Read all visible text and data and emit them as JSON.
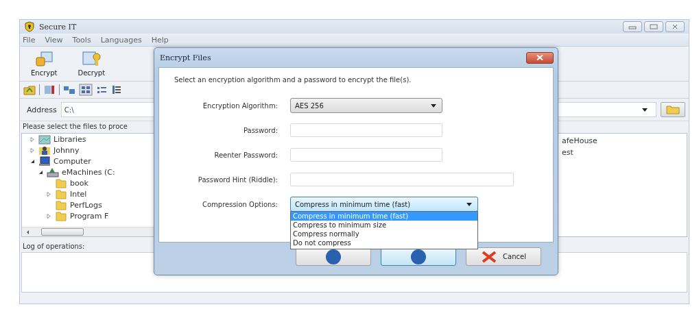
{
  "window": {
    "title": "Secure IT"
  },
  "menu": [
    "File",
    "View",
    "Tools",
    "Languages",
    "Help"
  ],
  "toolbar": [
    {
      "kind": "encrypt",
      "label": "Encrypt"
    },
    {
      "kind": "decrypt",
      "label": "Decrypt"
    }
  ],
  "address": {
    "label": "Address",
    "value": "C:\\"
  },
  "files_prompt": "Please select the files to proce",
  "tree": [
    {
      "kind": "libraries",
      "label": "Libraries",
      "expanded": false
    },
    {
      "kind": "user",
      "label": "Johnny",
      "expanded": false
    },
    {
      "kind": "computer",
      "label": "Computer",
      "expanded": true,
      "children": [
        {
          "kind": "drive",
          "label": "eMachines (C:",
          "expanded": true,
          "children": [
            {
              "kind": "folder",
              "label": "book"
            },
            {
              "kind": "folder",
              "label": "Intel",
              "expanded": false
            },
            {
              "kind": "folder",
              "label": "PerfLogs"
            },
            {
              "kind": "folder",
              "label": "Program F",
              "expanded": false
            }
          ]
        }
      ]
    }
  ],
  "file_list": [
    "afeHouse",
    "est"
  ],
  "log_label": "Log of operations:",
  "dialog": {
    "title": "Encrypt Files",
    "intro": "Select an encryption algorithm and a password to encrypt the file(s).",
    "fields": [
      {
        "kind": "dropdown",
        "label": "Encryption Algorithm:",
        "value": "AES 256"
      },
      {
        "kind": "password",
        "label": "Password:"
      },
      {
        "kind": "password",
        "label": "Reenter Password:"
      },
      {
        "kind": "text",
        "label": "Password Hint (Riddle):"
      },
      {
        "kind": "dropdown",
        "label": "Compression Options:",
        "value": "Compress in minimum time (fast)",
        "open": true,
        "options": [
          {
            "label": "Compress in minimum time (fast)",
            "selected": true
          },
          {
            "label": "Compress to minimum size",
            "selected": false
          },
          {
            "label": "Compress normally",
            "selected": false
          },
          {
            "label": "Do not compress",
            "selected": false
          }
        ]
      }
    ],
    "buttons": [
      {
        "kind": "previous",
        "default": false
      },
      {
        "kind": "next",
        "default": true
      },
      {
        "kind": "cancel",
        "label": "Cancel",
        "default": false
      }
    ]
  }
}
